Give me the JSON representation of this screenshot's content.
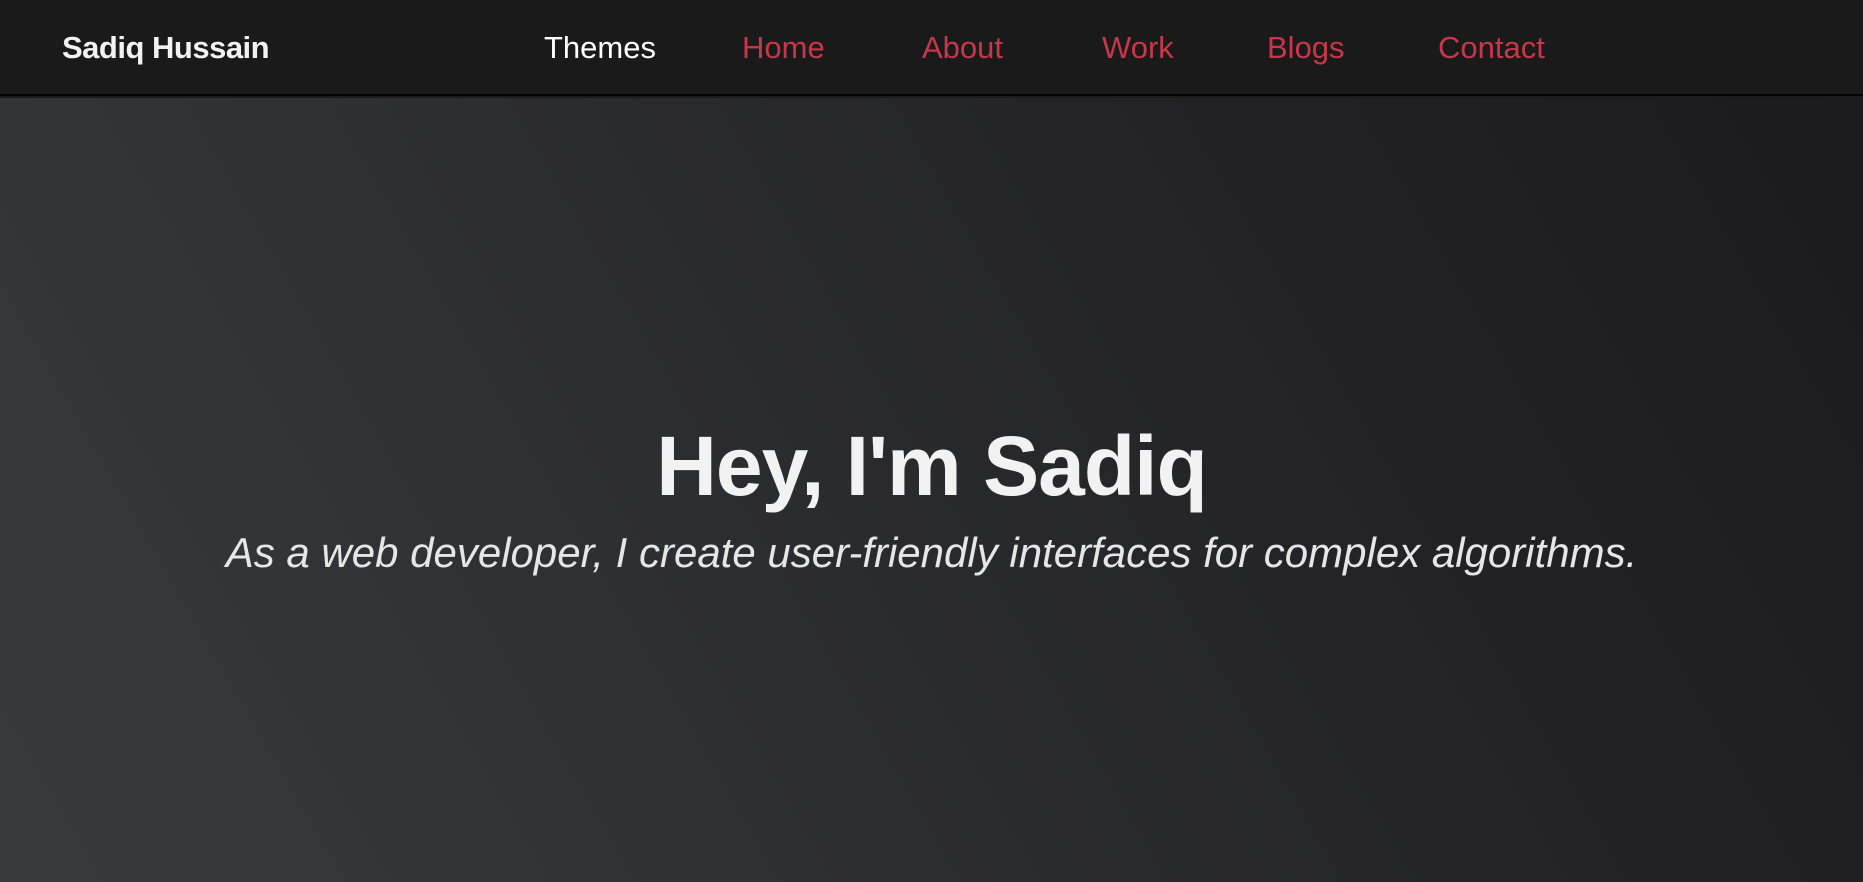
{
  "header": {
    "brand": "Sadiq Hussain",
    "nav": {
      "themes": "Themes",
      "home": "Home",
      "about": "About",
      "work": "Work",
      "blogs": "Blogs",
      "contact": "Contact"
    }
  },
  "hero": {
    "title": "Hey, I'm Sadiq",
    "subtitle": "As a web developer, I create user-friendly interfaces for complex algorithms."
  },
  "colors": {
    "accent": "#c8364a",
    "navbar_bg": "#1a1a1a",
    "hero_text": "#f2f2f2"
  }
}
